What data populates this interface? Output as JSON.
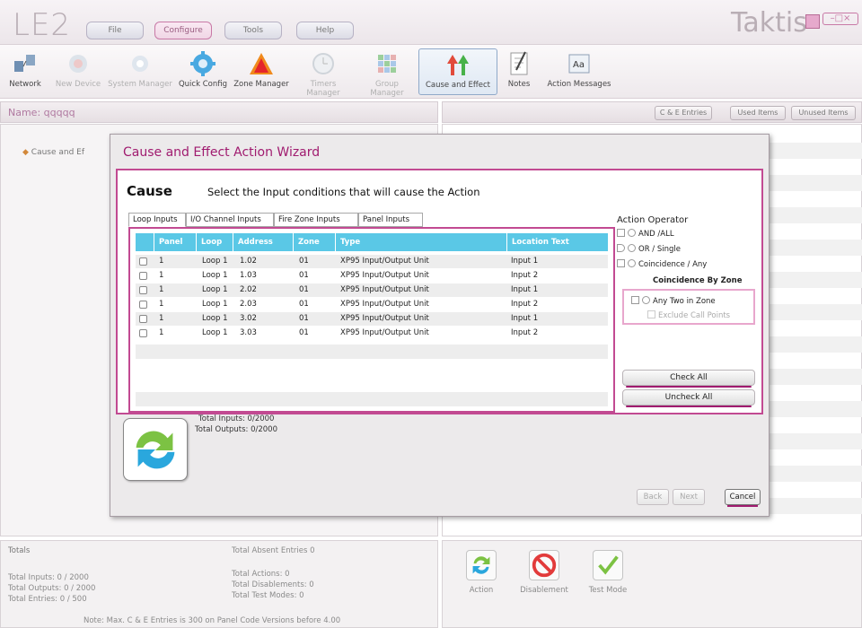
{
  "app": {
    "logo_text": "LE2",
    "brand": "Taktis",
    "window_controls": "–□×"
  },
  "menu": [
    "File",
    "Configure",
    "Tools",
    "Help"
  ],
  "toolbar": [
    {
      "label": "Network",
      "icon": "network-icon",
      "enabled": true
    },
    {
      "label": "New Device",
      "icon": "new-device-icon",
      "enabled": false
    },
    {
      "label": "System Manager",
      "icon": "system-manager-icon",
      "enabled": false
    },
    {
      "label": "Quick Config",
      "icon": "gear-icon",
      "enabled": true
    },
    {
      "label": "Zone Manager",
      "icon": "triangle-icon",
      "enabled": true
    },
    {
      "label": "Timers Manager",
      "icon": "clock-icon",
      "enabled": false
    },
    {
      "label": "Group Manager",
      "icon": "grid-icon",
      "enabled": false
    },
    {
      "label": "Cause and Effect",
      "icon": "cause-effect-icon",
      "enabled": true,
      "selected": true
    },
    {
      "label": "Notes",
      "icon": "notes-icon",
      "enabled": true
    },
    {
      "label": "Action Messages",
      "icon": "action-messages-icon",
      "enabled": true
    }
  ],
  "name_bar": {
    "label": "Name: qqqqq"
  },
  "right_buttons": [
    "C & E Entries",
    "Used Items",
    "Unused Items"
  ],
  "tree": {
    "item": "Cause and Ef"
  },
  "dialog": {
    "title": "Cause and Effect Action Wizard",
    "heading": "Cause",
    "subheading": "Select the Input conditions that will cause the Action",
    "tabs": [
      "Loop Inputs",
      "I/O Channel Inputs",
      "Fire Zone Inputs",
      "Panel Inputs"
    ],
    "columns": [
      "Panel",
      "Loop",
      "Address",
      "Zone",
      "Type",
      "Location Text"
    ],
    "rows": [
      {
        "panel": "1",
        "loop": "Loop 1",
        "address": "1.02",
        "zone": "01",
        "type": "XP95 Input/Output Unit",
        "location": "Input 1"
      },
      {
        "panel": "1",
        "loop": "Loop 1",
        "address": "1.03",
        "zone": "01",
        "type": "XP95 Input/Output Unit",
        "location": "Input 2"
      },
      {
        "panel": "1",
        "loop": "Loop 1",
        "address": "2.02",
        "zone": "01",
        "type": "XP95 Input/Output Unit",
        "location": "Input 1"
      },
      {
        "panel": "1",
        "loop": "Loop 1",
        "address": "2.03",
        "zone": "01",
        "type": "XP95 Input/Output Unit",
        "location": "Input 2"
      },
      {
        "panel": "1",
        "loop": "Loop 1",
        "address": "3.02",
        "zone": "01",
        "type": "XP95 Input/Output Unit",
        "location": "Input 1"
      },
      {
        "panel": "1",
        "loop": "Loop 1",
        "address": "3.03",
        "zone": "01",
        "type": "XP95 Input/Output Unit",
        "location": "Input 2"
      }
    ],
    "operator": {
      "title": "Action Operator",
      "and_all": "AND /ALL",
      "or_single": "OR / Single",
      "coincidence_any": "Coincidence / Any",
      "coincidence_zone": "Coincidence By Zone",
      "any_two": "Any Two in Zone",
      "exclude_call_points": "Exclude Call Points"
    },
    "check_all": "Check All",
    "uncheck_all": "Uncheck All",
    "total_inputs": "Total Inputs: 0/2000",
    "total_outputs": "Total Outputs: 0/2000",
    "back": "Back",
    "next": "Next",
    "cancel": "Cancel"
  },
  "totals": {
    "title": "Totals",
    "inputs": "Total Inputs: 0 / 2000",
    "outputs": "Total Outputs: 0 / 2000",
    "entries": "Total Entries: 0 / 500",
    "absent": "Total Absent Entries 0",
    "actions": "Total Actions: 0",
    "disablements": "Total Disablements: 0",
    "test_modes": "Total Test Modes: 0",
    "note": "Note: Max. C & E Entries is 300 on Panel Code Versions before 4.00"
  },
  "actions": [
    "Action",
    "Disablement",
    "Test Mode"
  ]
}
